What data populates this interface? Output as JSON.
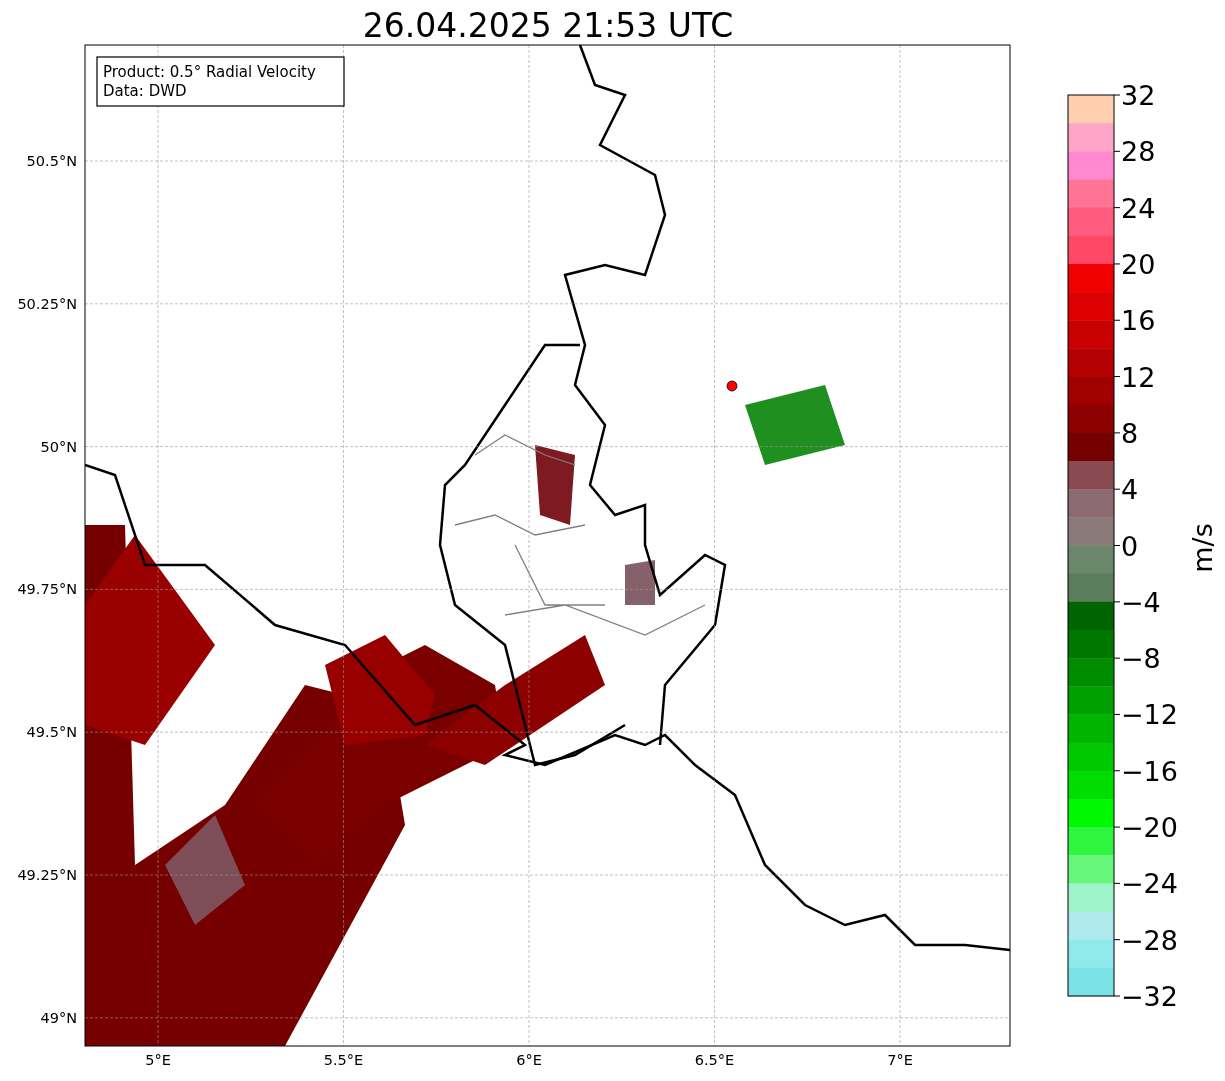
{
  "title": "26.04.2025 21:53 UTC",
  "map": {
    "legend_lines": [
      "Product: 0.5° Radial Velocity",
      "Data: DWD"
    ],
    "lat_labels": [
      "50.5°N",
      "50.25°N",
      "50°N",
      "49.75°N",
      "49.5°N",
      "49.25°N",
      "49°N"
    ],
    "lon_labels": [
      "5°E",
      "5.5°E",
      "6°E",
      "6.5°E",
      "7°E"
    ]
  },
  "colorbar": {
    "unit": "m/s",
    "ticks": [
      "32",
      "28",
      "24",
      "20",
      "16",
      "12",
      "8",
      "4",
      "0",
      "−4",
      "−8",
      "−12",
      "−16",
      "−20",
      "−24",
      "−28",
      "−32"
    ],
    "segments": [
      {
        "color": "#ffcfb0"
      },
      {
        "color": "#ffa6c8"
      },
      {
        "color": "#ff88d0"
      },
      {
        "color": "#ff7394"
      },
      {
        "color": "#ff5c80"
      },
      {
        "color": "#ff4866"
      },
      {
        "color": "#f00000"
      },
      {
        "color": "#dc0000"
      },
      {
        "color": "#c80000"
      },
      {
        "color": "#b40000"
      },
      {
        "color": "#a00000"
      },
      {
        "color": "#8c0000"
      },
      {
        "color": "#740000"
      },
      {
        "color": "#8a4a52"
      },
      {
        "color": "#8b6a72"
      },
      {
        "color": "#8a7a7a"
      },
      {
        "color": "#6b876b"
      },
      {
        "color": "#5a7d5a"
      },
      {
        "color": "#006400"
      },
      {
        "color": "#007800"
      },
      {
        "color": "#008c00"
      },
      {
        "color": "#00a000"
      },
      {
        "color": "#00b400"
      },
      {
        "color": "#00c800"
      },
      {
        "color": "#00dd00"
      },
      {
        "color": "#00f800"
      },
      {
        "color": "#2ff63e"
      },
      {
        "color": "#66f67a"
      },
      {
        "color": "#9ef3c8"
      },
      {
        "color": "#aee9ee"
      },
      {
        "color": "#90e9ec"
      },
      {
        "color": "#7be3e8"
      }
    ]
  }
}
